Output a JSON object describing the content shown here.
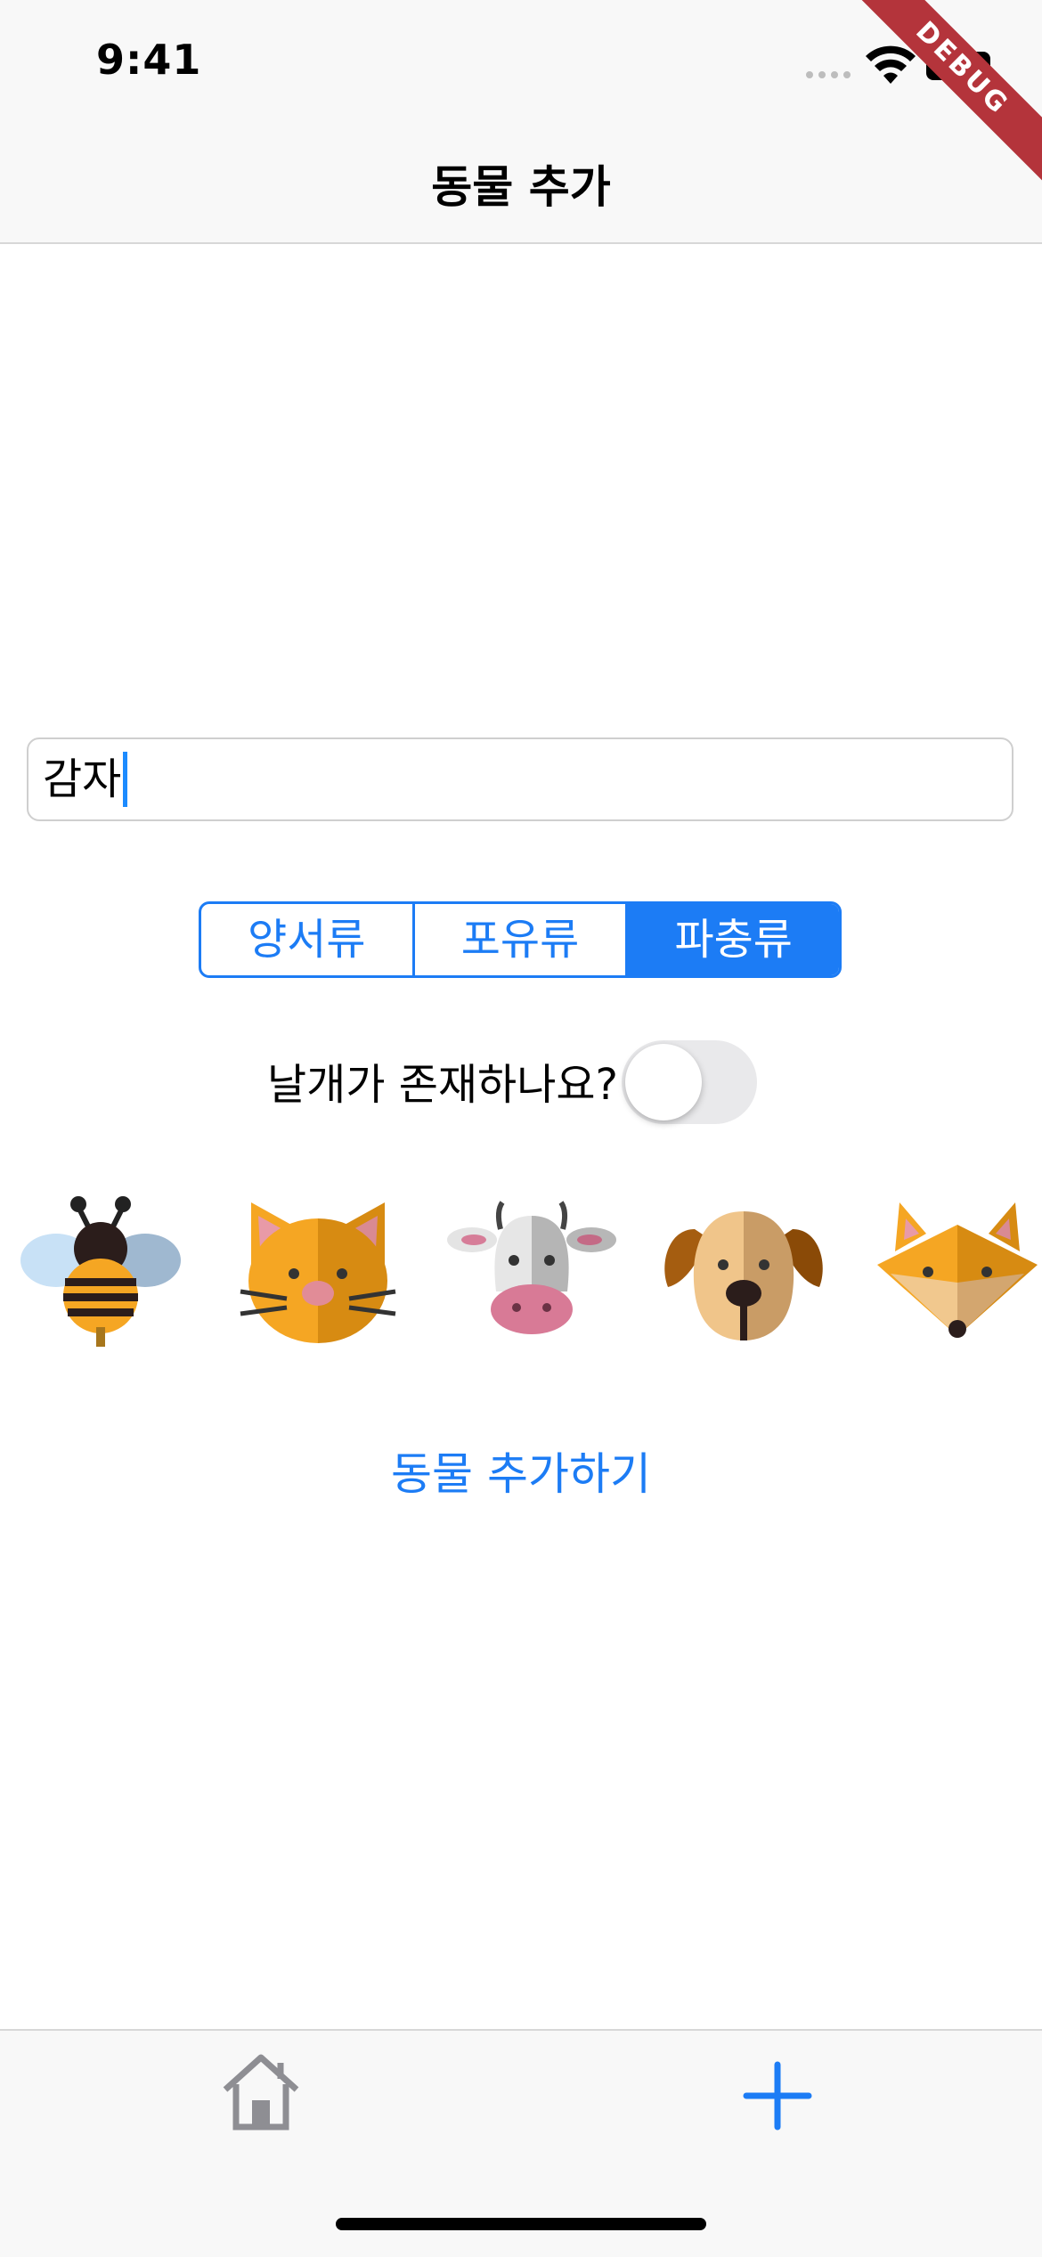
{
  "status_bar": {
    "time": "9:41"
  },
  "debug_banner": "DEBUG",
  "header": {
    "title": "동물 추가"
  },
  "form": {
    "name_value": "감자",
    "segments": [
      "양서류",
      "포유류",
      "파충류"
    ],
    "selected_segment": "파충류",
    "wing_question": "날개가 존재하나요?",
    "wing_toggle_on": false,
    "animals": [
      "bee",
      "cat",
      "cow",
      "dog",
      "fox"
    ],
    "add_button_label": "동물 추가하기"
  },
  "tabbar": {
    "items": [
      {
        "icon": "house-icon",
        "color": "#8e8e93"
      },
      {
        "icon": "plus-icon",
        "color": "#1c7cf5"
      }
    ]
  },
  "colors": {
    "accent": "#1c7cf5"
  }
}
